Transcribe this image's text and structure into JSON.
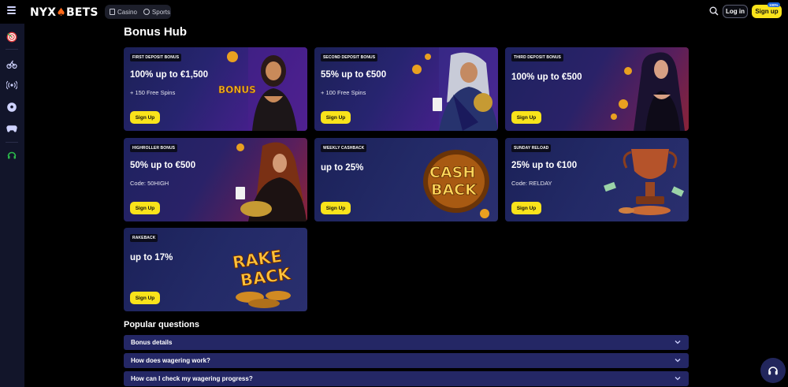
{
  "header": {
    "logo": {
      "left": "NYX",
      "right": "BETS",
      "mark": "♠"
    },
    "tabs": [
      {
        "label": "Casino",
        "icon": "cards-icon"
      },
      {
        "label": "Sports",
        "icon": "soccer-ball-icon"
      }
    ],
    "login_label": "Log in",
    "signup_label": "Sign up",
    "signup_badge": "100%"
  },
  "sidebar": {
    "items": [
      {
        "icon": "target-icon"
      },
      {
        "icon": "cycling-icon"
      },
      {
        "icon": "live-broadcast-icon"
      },
      {
        "icon": "soccer-icon"
      },
      {
        "icon": "gamepad-icon"
      },
      {
        "icon": "support-headset-icon"
      }
    ]
  },
  "page_title": "Bonus Hub",
  "bonuses": [
    {
      "tag": "FIRST DEPOSIT BONUS",
      "title": "100% up to €1,500",
      "sub": "+ 150 Free Spins",
      "cta": "Sign Up"
    },
    {
      "tag": "SECOND DEPOSIT BONUS",
      "title": "55% up to €500",
      "sub": "+ 100 Free Spins",
      "cta": "Sign Up"
    },
    {
      "tag": "THIRD DEPOSIT BONUS",
      "title": "100% up to €500",
      "sub": "",
      "cta": "Sign Up"
    },
    {
      "tag": "HIGHROLLER BONUS",
      "title": "50% up to €500",
      "sub": "Code: 50HIGH",
      "cta": "Sign Up"
    },
    {
      "tag": "WEEKLY CASHBACK",
      "title": "up to 25%",
      "sub": "",
      "cta": "Sign Up",
      "art_text": [
        "CASH",
        "BACK"
      ]
    },
    {
      "tag": "SUNDAY RELOAD",
      "title": "25% up to €100",
      "sub": "Code: RELDAY",
      "cta": "Sign Up"
    },
    {
      "tag": "RAKEBACK",
      "title": "up to 17%",
      "sub": "",
      "cta": "Sign Up",
      "art_text": [
        "RAKE",
        "BACK"
      ]
    }
  ],
  "faq_title": "Popular questions",
  "faq": [
    {
      "q": "Bonus details"
    },
    {
      "q": "How does wagering work?"
    },
    {
      "q": "How can I check my wagering progress?"
    }
  ],
  "colors": {
    "accent": "#f9e31b",
    "card": "#242765",
    "bg": "#000000",
    "sidebar": "#12152a"
  }
}
